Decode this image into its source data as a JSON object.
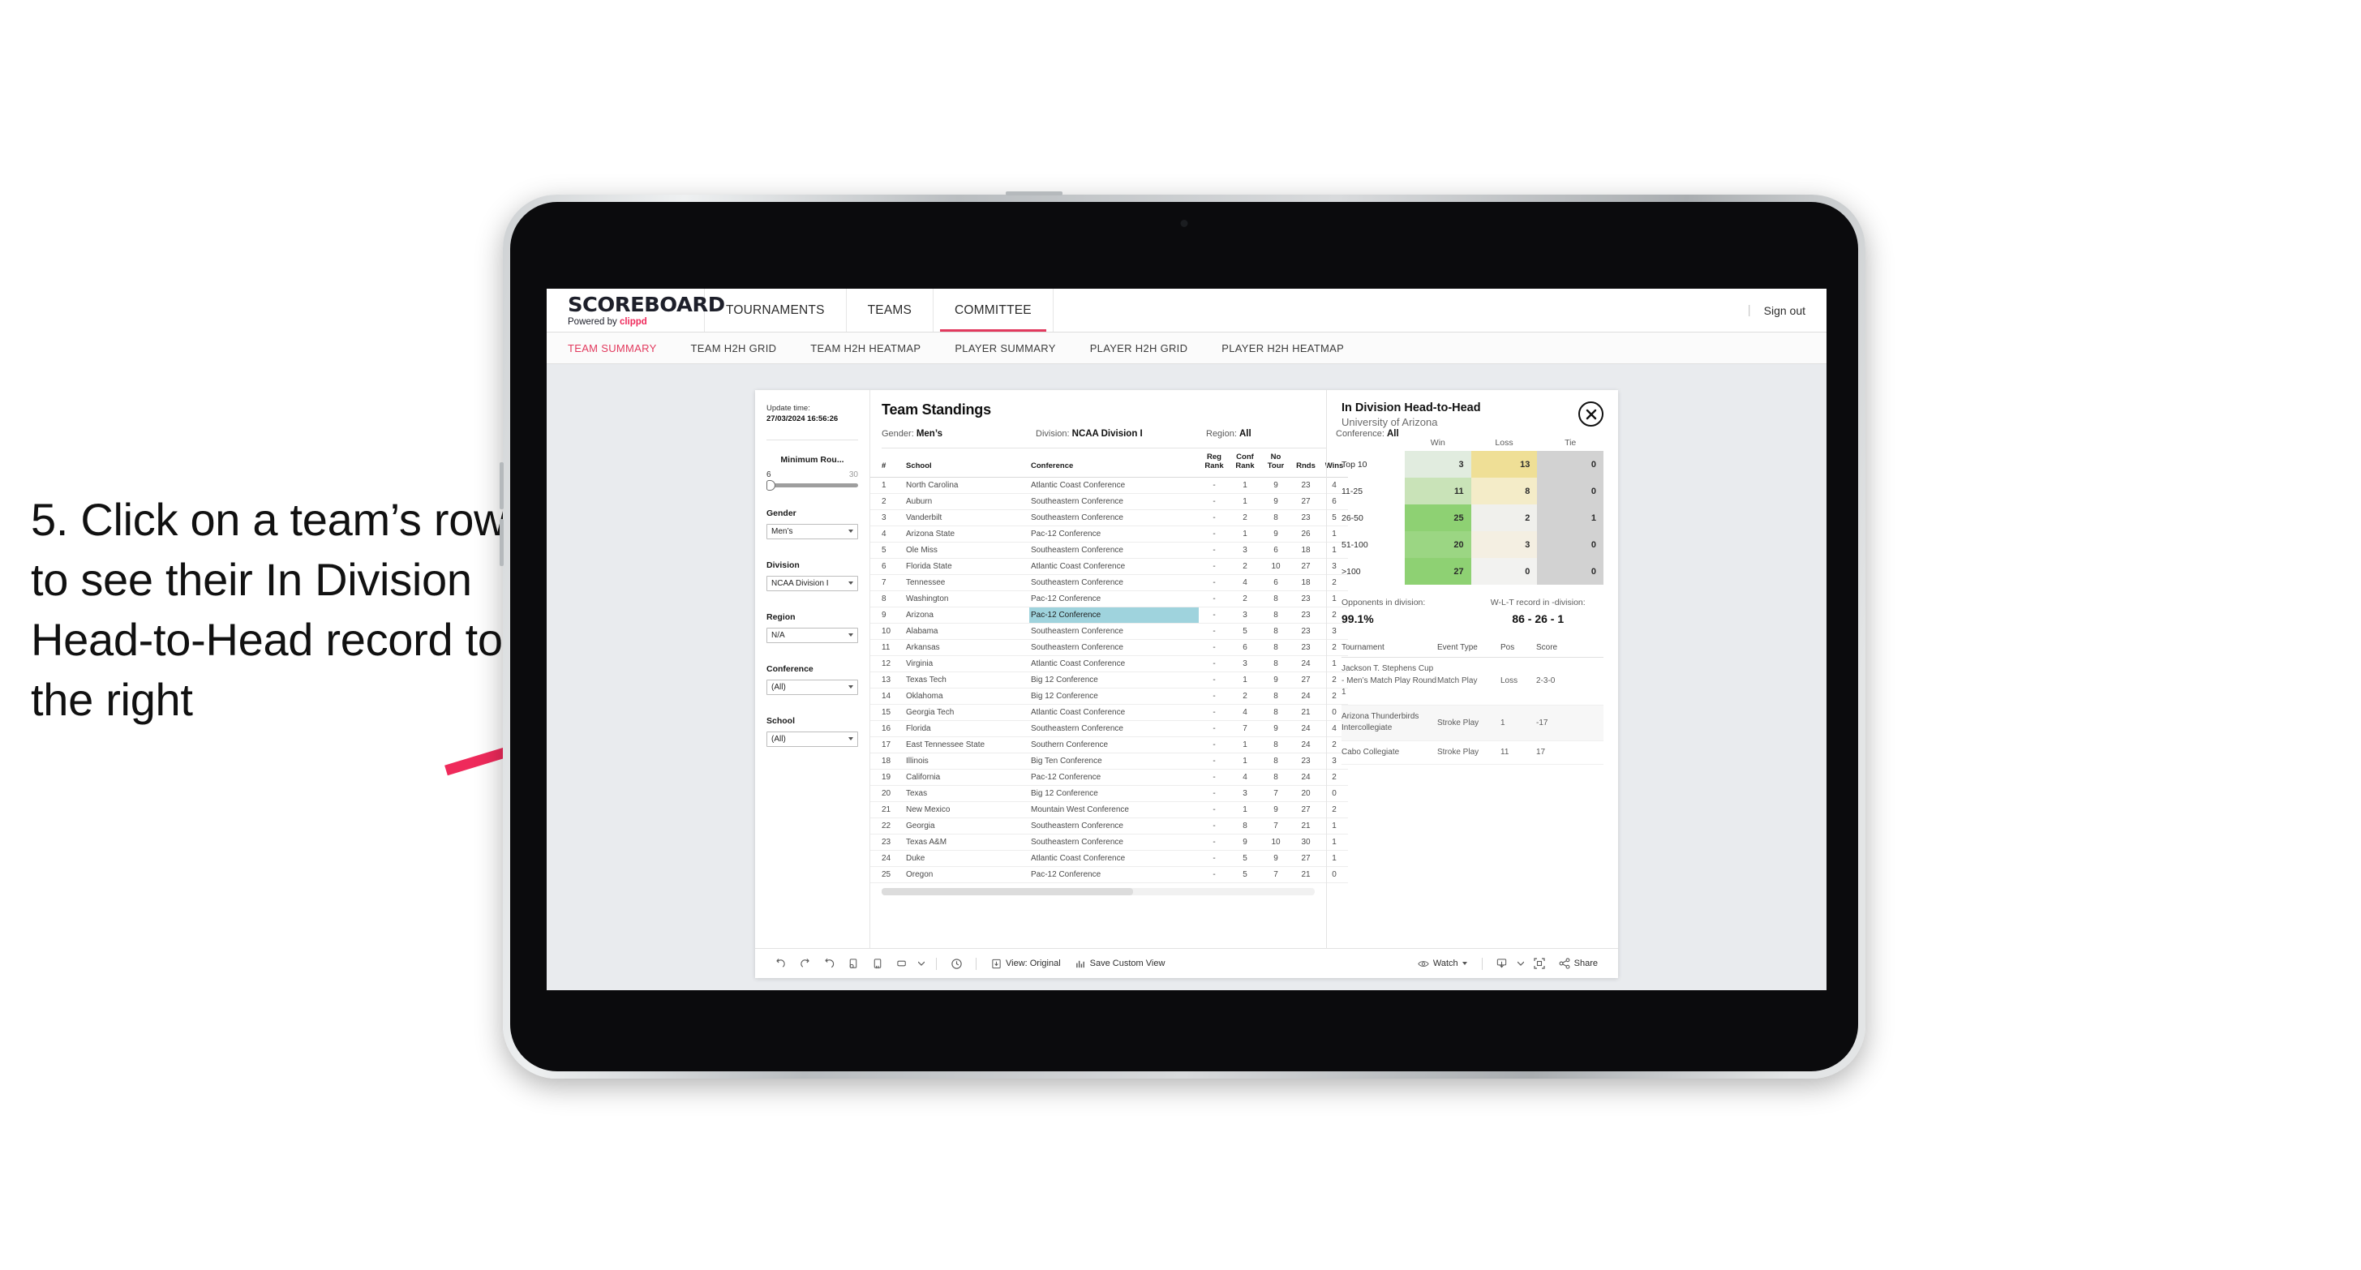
{
  "annotation": {
    "text": "5. Click on a team’s row to see their In Division Head-to-Head record to the right",
    "arrow_color": "#ef2a5b"
  },
  "header": {
    "logo_word": "SCOREBOARD",
    "logo_powered": "Powered by ",
    "logo_brand": "clippd",
    "nav": [
      {
        "label": "TOURNAMENTS",
        "active": false
      },
      {
        "label": "TEAMS",
        "active": false
      },
      {
        "label": "COMMITTEE",
        "active": true
      }
    ],
    "separator": "|",
    "sign_out": "Sign out",
    "accent": "#e23a5e"
  },
  "subnav": {
    "tabs": [
      {
        "label": "TEAM SUMMARY",
        "active": true
      },
      {
        "label": "TEAM H2H GRID",
        "active": false
      },
      {
        "label": "TEAM H2H HEATMAP",
        "active": false
      },
      {
        "label": "PLAYER SUMMARY",
        "active": false
      },
      {
        "label": "PLAYER H2H GRID",
        "active": false
      },
      {
        "label": "PLAYER H2H HEATMAP",
        "active": false
      }
    ]
  },
  "filters": {
    "update_label": "Update time:",
    "update_value": "27/03/2024 16:56:26",
    "min_rounds": {
      "title": "Minimum Rou...",
      "min": "6",
      "max": "30"
    },
    "selects": [
      {
        "title": "Gender",
        "value": "Men’s"
      },
      {
        "title": "Division",
        "value": "NCAA Division I"
      },
      {
        "title": "Region",
        "value": "N/A"
      },
      {
        "title": "Conference",
        "value": "(All)"
      },
      {
        "title": "School",
        "value": "(All)"
      }
    ]
  },
  "standings": {
    "title": "Team Standings",
    "meta": [
      {
        "label": "Gender:",
        "value": "Men’s"
      },
      {
        "label": "Division:",
        "value": "NCAA Division I"
      },
      {
        "label": "Region:",
        "value": "All"
      },
      {
        "label": "Conference:",
        "value": "All"
      }
    ],
    "columns": [
      "#",
      "School",
      "Conference",
      "Reg Rank",
      "Conf Rank",
      "No Tour",
      "Rnds",
      "Wins"
    ],
    "columns_split": [
      {
        "l1": "#",
        "l2": ""
      },
      {
        "l1": "School",
        "l2": ""
      },
      {
        "l1": "Conference",
        "l2": ""
      },
      {
        "l1": "Reg",
        "l2": "Rank"
      },
      {
        "l1": "Conf",
        "l2": "Rank"
      },
      {
        "l1": "No",
        "l2": "Tour"
      },
      {
        "l1": "Rnds",
        "l2": ""
      },
      {
        "l1": "Wins",
        "l2": ""
      }
    ],
    "highlight_row": 9,
    "highlight_color": "#9fd3dd",
    "rows": [
      {
        "rank": "1",
        "school": "North Carolina",
        "conf": "Atlantic Coast Conference",
        "reg": "-",
        "confrank": "1",
        "notour": "9",
        "rnds": "23",
        "wins": "4"
      },
      {
        "rank": "2",
        "school": "Auburn",
        "conf": "Southeastern Conference",
        "reg": "-",
        "confrank": "1",
        "notour": "9",
        "rnds": "27",
        "wins": "6"
      },
      {
        "rank": "3",
        "school": "Vanderbilt",
        "conf": "Southeastern Conference",
        "reg": "-",
        "confrank": "2",
        "notour": "8",
        "rnds": "23",
        "wins": "5"
      },
      {
        "rank": "4",
        "school": "Arizona State",
        "conf": "Pac-12 Conference",
        "reg": "-",
        "confrank": "1",
        "notour": "9",
        "rnds": "26",
        "wins": "1"
      },
      {
        "rank": "5",
        "school": "Ole Miss",
        "conf": "Southeastern Conference",
        "reg": "-",
        "confrank": "3",
        "notour": "6",
        "rnds": "18",
        "wins": "1"
      },
      {
        "rank": "6",
        "school": "Florida State",
        "conf": "Atlantic Coast Conference",
        "reg": "-",
        "confrank": "2",
        "notour": "10",
        "rnds": "27",
        "wins": "3"
      },
      {
        "rank": "7",
        "school": "Tennessee",
        "conf": "Southeastern Conference",
        "reg": "-",
        "confrank": "4",
        "notour": "6",
        "rnds": "18",
        "wins": "2"
      },
      {
        "rank": "8",
        "school": "Washington",
        "conf": "Pac-12 Conference",
        "reg": "-",
        "confrank": "2",
        "notour": "8",
        "rnds": "23",
        "wins": "1"
      },
      {
        "rank": "9",
        "school": "Arizona",
        "conf": "Pac-12 Conference",
        "reg": "-",
        "confrank": "3",
        "notour": "8",
        "rnds": "23",
        "wins": "2"
      },
      {
        "rank": "10",
        "school": "Alabama",
        "conf": "Southeastern Conference",
        "reg": "-",
        "confrank": "5",
        "notour": "8",
        "rnds": "23",
        "wins": "3"
      },
      {
        "rank": "11",
        "school": "Arkansas",
        "conf": "Southeastern Conference",
        "reg": "-",
        "confrank": "6",
        "notour": "8",
        "rnds": "23",
        "wins": "2"
      },
      {
        "rank": "12",
        "school": "Virginia",
        "conf": "Atlantic Coast Conference",
        "reg": "-",
        "confrank": "3",
        "notour": "8",
        "rnds": "24",
        "wins": "1"
      },
      {
        "rank": "13",
        "school": "Texas Tech",
        "conf": "Big 12 Conference",
        "reg": "-",
        "confrank": "1",
        "notour": "9",
        "rnds": "27",
        "wins": "2"
      },
      {
        "rank": "14",
        "school": "Oklahoma",
        "conf": "Big 12 Conference",
        "reg": "-",
        "confrank": "2",
        "notour": "8",
        "rnds": "24",
        "wins": "2"
      },
      {
        "rank": "15",
        "school": "Georgia Tech",
        "conf": "Atlantic Coast Conference",
        "reg": "-",
        "confrank": "4",
        "notour": "8",
        "rnds": "21",
        "wins": "0"
      },
      {
        "rank": "16",
        "school": "Florida",
        "conf": "Southeastern Conference",
        "reg": "-",
        "confrank": "7",
        "notour": "9",
        "rnds": "24",
        "wins": "4"
      },
      {
        "rank": "17",
        "school": "East Tennessee State",
        "conf": "Southern Conference",
        "reg": "-",
        "confrank": "1",
        "notour": "8",
        "rnds": "24",
        "wins": "2"
      },
      {
        "rank": "18",
        "school": "Illinois",
        "conf": "Big Ten Conference",
        "reg": "-",
        "confrank": "1",
        "notour": "8",
        "rnds": "23",
        "wins": "3"
      },
      {
        "rank": "19",
        "school": "California",
        "conf": "Pac-12 Conference",
        "reg": "-",
        "confrank": "4",
        "notour": "8",
        "rnds": "24",
        "wins": "2"
      },
      {
        "rank": "20",
        "school": "Texas",
        "conf": "Big 12 Conference",
        "reg": "-",
        "confrank": "3",
        "notour": "7",
        "rnds": "20",
        "wins": "0"
      },
      {
        "rank": "21",
        "school": "New Mexico",
        "conf": "Mountain West Conference",
        "reg": "-",
        "confrank": "1",
        "notour": "9",
        "rnds": "27",
        "wins": "2"
      },
      {
        "rank": "22",
        "school": "Georgia",
        "conf": "Southeastern Conference",
        "reg": "-",
        "confrank": "8",
        "notour": "7",
        "rnds": "21",
        "wins": "1"
      },
      {
        "rank": "23",
        "school": "Texas A&M",
        "conf": "Southeastern Conference",
        "reg": "-",
        "confrank": "9",
        "notour": "10",
        "rnds": "30",
        "wins": "1"
      },
      {
        "rank": "24",
        "school": "Duke",
        "conf": "Atlantic Coast Conference",
        "reg": "-",
        "confrank": "5",
        "notour": "9",
        "rnds": "27",
        "wins": "1"
      },
      {
        "rank": "25",
        "school": "Oregon",
        "conf": "Pac-12 Conference",
        "reg": "-",
        "confrank": "5",
        "notour": "7",
        "rnds": "21",
        "wins": "0"
      }
    ]
  },
  "h2h": {
    "title": "In Division Head-to-Head",
    "subtitle": "University of Arizona",
    "close_icon": "close-icon",
    "grid": {
      "columns": [
        "Win",
        "Loss",
        "Tie"
      ],
      "rows": [
        {
          "label": "Top 10",
          "win": "3",
          "loss": "13",
          "tie": "0",
          "win_color": "#e1ecdf",
          "loss_color": "#efdf96",
          "tie_color": "#d2d2d2"
        },
        {
          "label": "11-25",
          "win": "11",
          "loss": "8",
          "tie": "0",
          "win_color": "#c9e3b8",
          "loss_color": "#f4ecc8",
          "tie_color": "#d2d2d2"
        },
        {
          "label": "26-50",
          "win": "25",
          "loss": "2",
          "tie": "1",
          "win_color": "#8ed173",
          "loss_color": "#f0f0ec",
          "tie_color": "#d2d2d2"
        },
        {
          "label": "51-100",
          "win": "20",
          "loss": "3",
          "tie": "0",
          "win_color": "#9bd683",
          "loss_color": "#f4efe2",
          "tie_color": "#d2d2d2"
        },
        {
          "label": ">100",
          "win": "27",
          "loss": "0",
          "tie": "0",
          "win_color": "#8ed173",
          "loss_color": "#f2f2f0",
          "tie_color": "#d2d2d2"
        }
      ]
    },
    "summary": [
      {
        "label": "Opponents in division:",
        "value": "99.1%"
      },
      {
        "label": "W-L-T record in -division:",
        "value": "86 - 26 - 1"
      }
    ],
    "tournaments": {
      "columns": [
        "Tournament",
        "Event Type",
        "Pos",
        "Score"
      ],
      "rows": [
        {
          "name": "Jackson T. Stephens Cup - Men’s Match Play Round 1",
          "type": "Match Play",
          "pos": "Loss",
          "score": "2-3-0"
        },
        {
          "name": "Arizona Thunderbirds Intercollegiate",
          "type": "Stroke Play",
          "pos": "1",
          "score": "-17"
        },
        {
          "name": "Cabo Collegiate",
          "type": "Stroke Play",
          "pos": "11",
          "score": "17"
        }
      ]
    }
  },
  "toolbar": {
    "icons": [
      "undo-icon",
      "redo-icon",
      "revert-icon",
      "refresh-data-icon",
      "pause-icon",
      "layout-icon",
      "chevron-down-icon"
    ],
    "alert_icon": "alert-clock-icon",
    "view_label": "View: Original",
    "save_label": "Save Custom View",
    "watch_label": "Watch",
    "download_icon": "download-icon",
    "fullscreen_icon": "fullscreen-icon",
    "share_label": "Share"
  }
}
